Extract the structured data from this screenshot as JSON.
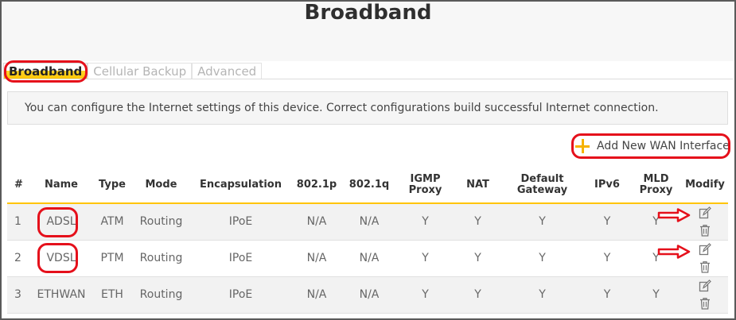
{
  "page": {
    "title": "Broadband"
  },
  "tabs": [
    {
      "label": "Broadband",
      "active": true
    },
    {
      "label": "Cellular Backup",
      "active": false
    },
    {
      "label": "Advanced",
      "active": false
    }
  ],
  "info": {
    "text": "You can configure the Internet settings of this device. Correct configurations build successful Internet connection."
  },
  "actions": {
    "add_wan_label": "Add New WAN Interface",
    "add_icon": "plus-icon"
  },
  "table": {
    "headers": [
      "#",
      "Name",
      "Type",
      "Mode",
      "Encapsulation",
      "802.1p",
      "802.1q",
      "IGMP Proxy",
      "NAT",
      "Default Gateway",
      "IPv6",
      "MLD Proxy",
      "Modify"
    ],
    "rows": [
      {
        "num": "1",
        "name": "ADSL",
        "type": "ATM",
        "mode": "Routing",
        "encapsulation": "IPoE",
        "p8021p": "N/A",
        "p8021q": "N/A",
        "igmp_proxy": "Y",
        "nat": "Y",
        "default_gateway": "Y",
        "ipv6": "Y",
        "mld_proxy": "Y"
      },
      {
        "num": "2",
        "name": "VDSL",
        "type": "PTM",
        "mode": "Routing",
        "encapsulation": "IPoE",
        "p8021p": "N/A",
        "p8021q": "N/A",
        "igmp_proxy": "Y",
        "nat": "Y",
        "default_gateway": "Y",
        "ipv6": "Y",
        "mld_proxy": "Y"
      },
      {
        "num": "3",
        "name": "ETHWAN",
        "type": "ETH",
        "mode": "Routing",
        "encapsulation": "IPoE",
        "p8021p": "N/A",
        "p8021q": "N/A",
        "igmp_proxy": "Y",
        "nat": "Y",
        "default_gateway": "Y",
        "ipv6": "Y",
        "mld_proxy": "Y"
      }
    ],
    "row_icons": {
      "edit": "edit-icon",
      "delete": "trash-icon"
    }
  },
  "colors": {
    "accent": "#ffc400",
    "annotation": "#e5101b",
    "text": "#333333",
    "muted": "#666666"
  }
}
